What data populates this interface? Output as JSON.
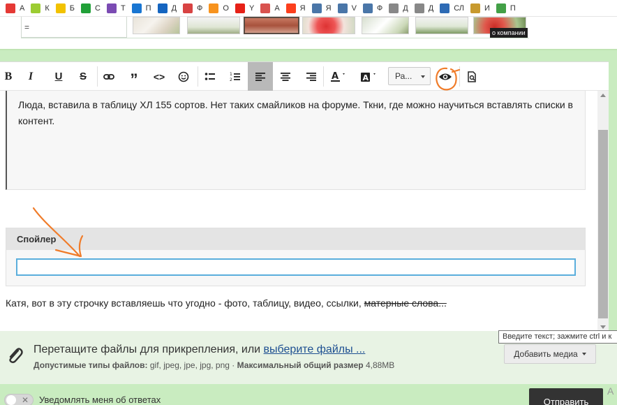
{
  "bookmarks": [
    {
      "label": "А",
      "icon": "site-favicon",
      "color": "#e53935"
    },
    {
      "label": "К",
      "icon": "site-favicon",
      "color": "#9ccc32"
    },
    {
      "label": "Б",
      "icon": "beeline-icon",
      "color": "#f2c200"
    },
    {
      "label": "С",
      "icon": "sber-icon",
      "color": "#21a038"
    },
    {
      "label": "Т",
      "icon": "site-favicon",
      "color": "#7b4bb3"
    },
    {
      "label": "П",
      "icon": "site-favicon",
      "color": "#1976d2"
    },
    {
      "label": "Д",
      "icon": "site-favicon",
      "color": "#1565c0"
    },
    {
      "label": "Ф",
      "icon": "camera-icon",
      "color": "#d84343"
    },
    {
      "label": "О",
      "icon": "odnoklassniki-icon",
      "color": "#f7931e"
    },
    {
      "label": "Y",
      "icon": "youtube-icon",
      "color": "#e62117"
    },
    {
      "label": "А",
      "icon": "site-favicon",
      "color": "#d9534f"
    },
    {
      "label": "Я",
      "icon": "yandex-icon",
      "color": "#fc3f1d"
    },
    {
      "label": "Я",
      "icon": "vk-icon",
      "color": "#4a76a8"
    },
    {
      "label": "V",
      "icon": "vk-icon",
      "color": "#4a76a8"
    },
    {
      "label": "Ф",
      "icon": "vk-icon",
      "color": "#4a76a8"
    },
    {
      "label": "Д",
      "icon": "document-icon",
      "color": "#888888"
    },
    {
      "label": "Д",
      "icon": "document-icon",
      "color": "#888888"
    },
    {
      "label": "СЛ",
      "icon": "globe-icon",
      "color": "#2e6bb5"
    },
    {
      "label": "И",
      "icon": "site-favicon",
      "color": "#c89a2e"
    },
    {
      "label": "П",
      "icon": "site-favicon",
      "color": "#43a047"
    }
  ],
  "top_strip": {
    "left_box_text": "=",
    "about_label": "о компании"
  },
  "toolbar": {
    "paragraph_select": "Ра..."
  },
  "editor": {
    "quote_text": "Люда, вставила в таблицу ХЛ 155 сортов. Нет таких смайликов на форуме. Ткни, где можно научиться вставлять списки в контент.",
    "spoiler_title": "Спойлер",
    "spoiler_input_value": "",
    "message_text": "Катя, вот в эту строчку вставляешь что угодно - фото, таблицу, видео, ссылки, ",
    "message_strike": "матерные слова..."
  },
  "attachments": {
    "drop_text": "Перетащите файлы для прикрепления, или ",
    "choose_link": "выберите файлы ...",
    "types_label": "Допустимые типы файлов:",
    "types_value": "gif, jpeg, jpe, jpg, png",
    "separator": "·",
    "max_label": "Максимальный общий размер",
    "max_value": "4,88MB",
    "add_media_label": "Добавить медиа"
  },
  "tooltip": "Введите текст; зажмите ctrl и к",
  "bottom": {
    "notify_label": "Уведомлять меня об ответах",
    "reply_button": "Отправить"
  },
  "colors": {
    "green_frame": "#c9ecc0",
    "attach_bg": "#e8f3e4",
    "active_button": "#b9b9b9",
    "spoiler_input_border": "#5aaedc",
    "annotation": "#f07c2a"
  }
}
